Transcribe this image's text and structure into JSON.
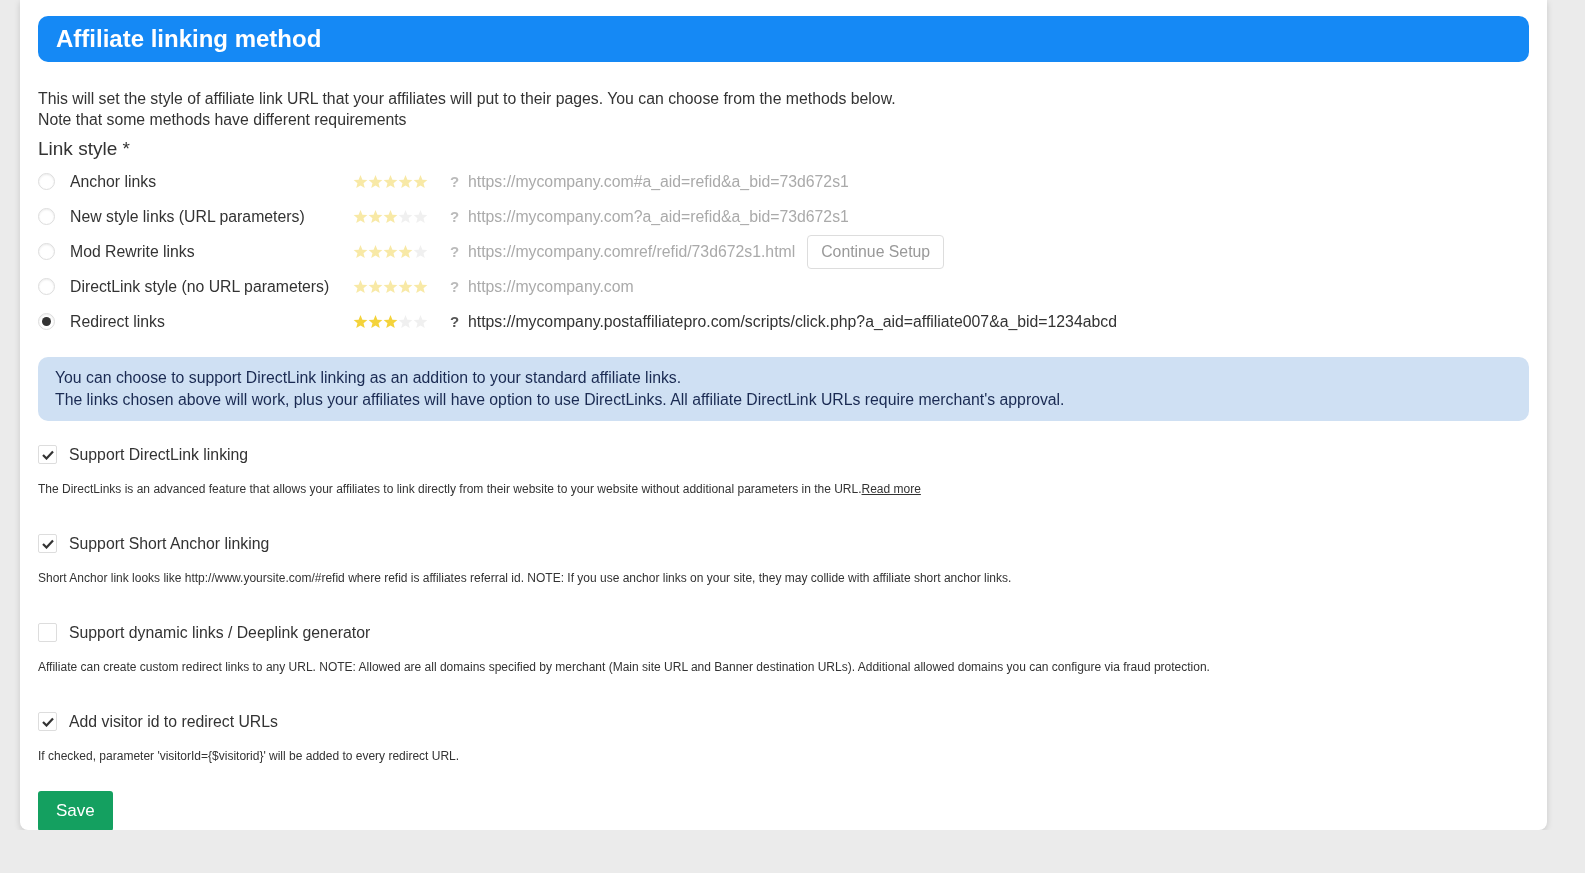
{
  "header": {
    "title": "Affiliate linking method"
  },
  "intro": [
    "This will set the style of affiliate link URL that your affiliates will put to their pages. You can choose from the methods below.",
    "Note that some methods have different requirements"
  ],
  "link_style": {
    "label": "Link style *",
    "methods": [
      {
        "label": "Anchor links",
        "selected": false,
        "stars": 5,
        "help": "?",
        "url": "https://mycompany.com#a_aid=refid&a_bid=73d672s1"
      },
      {
        "label": "New style links (URL parameters)",
        "selected": false,
        "stars": 3,
        "help": "?",
        "url": "https://mycompany.com?a_aid=refid&a_bid=73d672s1"
      },
      {
        "label": "Mod Rewrite links",
        "selected": false,
        "stars": 4,
        "help": "?",
        "url": "https://mycompany.comref/refid/73d672s1.html",
        "button": "Continue Setup"
      },
      {
        "label": "DirectLink style (no URL parameters)",
        "selected": false,
        "stars": 5,
        "help": "?",
        "url": "https://mycompany.com"
      },
      {
        "label": "Redirect links",
        "selected": true,
        "stars": 3,
        "help": "?",
        "url": "https://mycompany.postaffiliatepro.com/scripts/click.php?a_aid=affiliate007&a_bid=1234abcd"
      }
    ]
  },
  "info": [
    "You can choose to support DirectLink linking as an addition to your standard affiliate links.",
    "The links chosen above will work, plus your affiliates will have option to use DirectLinks. All affiliate DirectLink URLs require merchant's approval."
  ],
  "options": [
    {
      "label": "Support DirectLink linking",
      "checked": true,
      "description": "The DirectLinks is an advanced feature that allows your affiliates to link directly from their website to your website without additional parameters in the URL.",
      "link": "Read more"
    },
    {
      "label": "Support Short Anchor linking",
      "checked": true,
      "description": "Short Anchor link looks like http://www.yoursite.com/#refid where refid is affiliates referral id. NOTE: If you use anchor links on your site, they may collide with affiliate short anchor links."
    },
    {
      "label": "Support dynamic links / Deeplink generator",
      "checked": false,
      "description": "Affiliate can create custom redirect links to any URL. NOTE: Allowed are all domains specified by merchant (Main site URL and Banner destination URLs). Additional allowed domains you can configure via fraud protection."
    },
    {
      "label": "Add visitor id to redirect URLs",
      "checked": true,
      "description": "If checked, parameter 'visitorId={$visitorid}' will be added to every redirect URL."
    }
  ],
  "save_button": "Save"
}
